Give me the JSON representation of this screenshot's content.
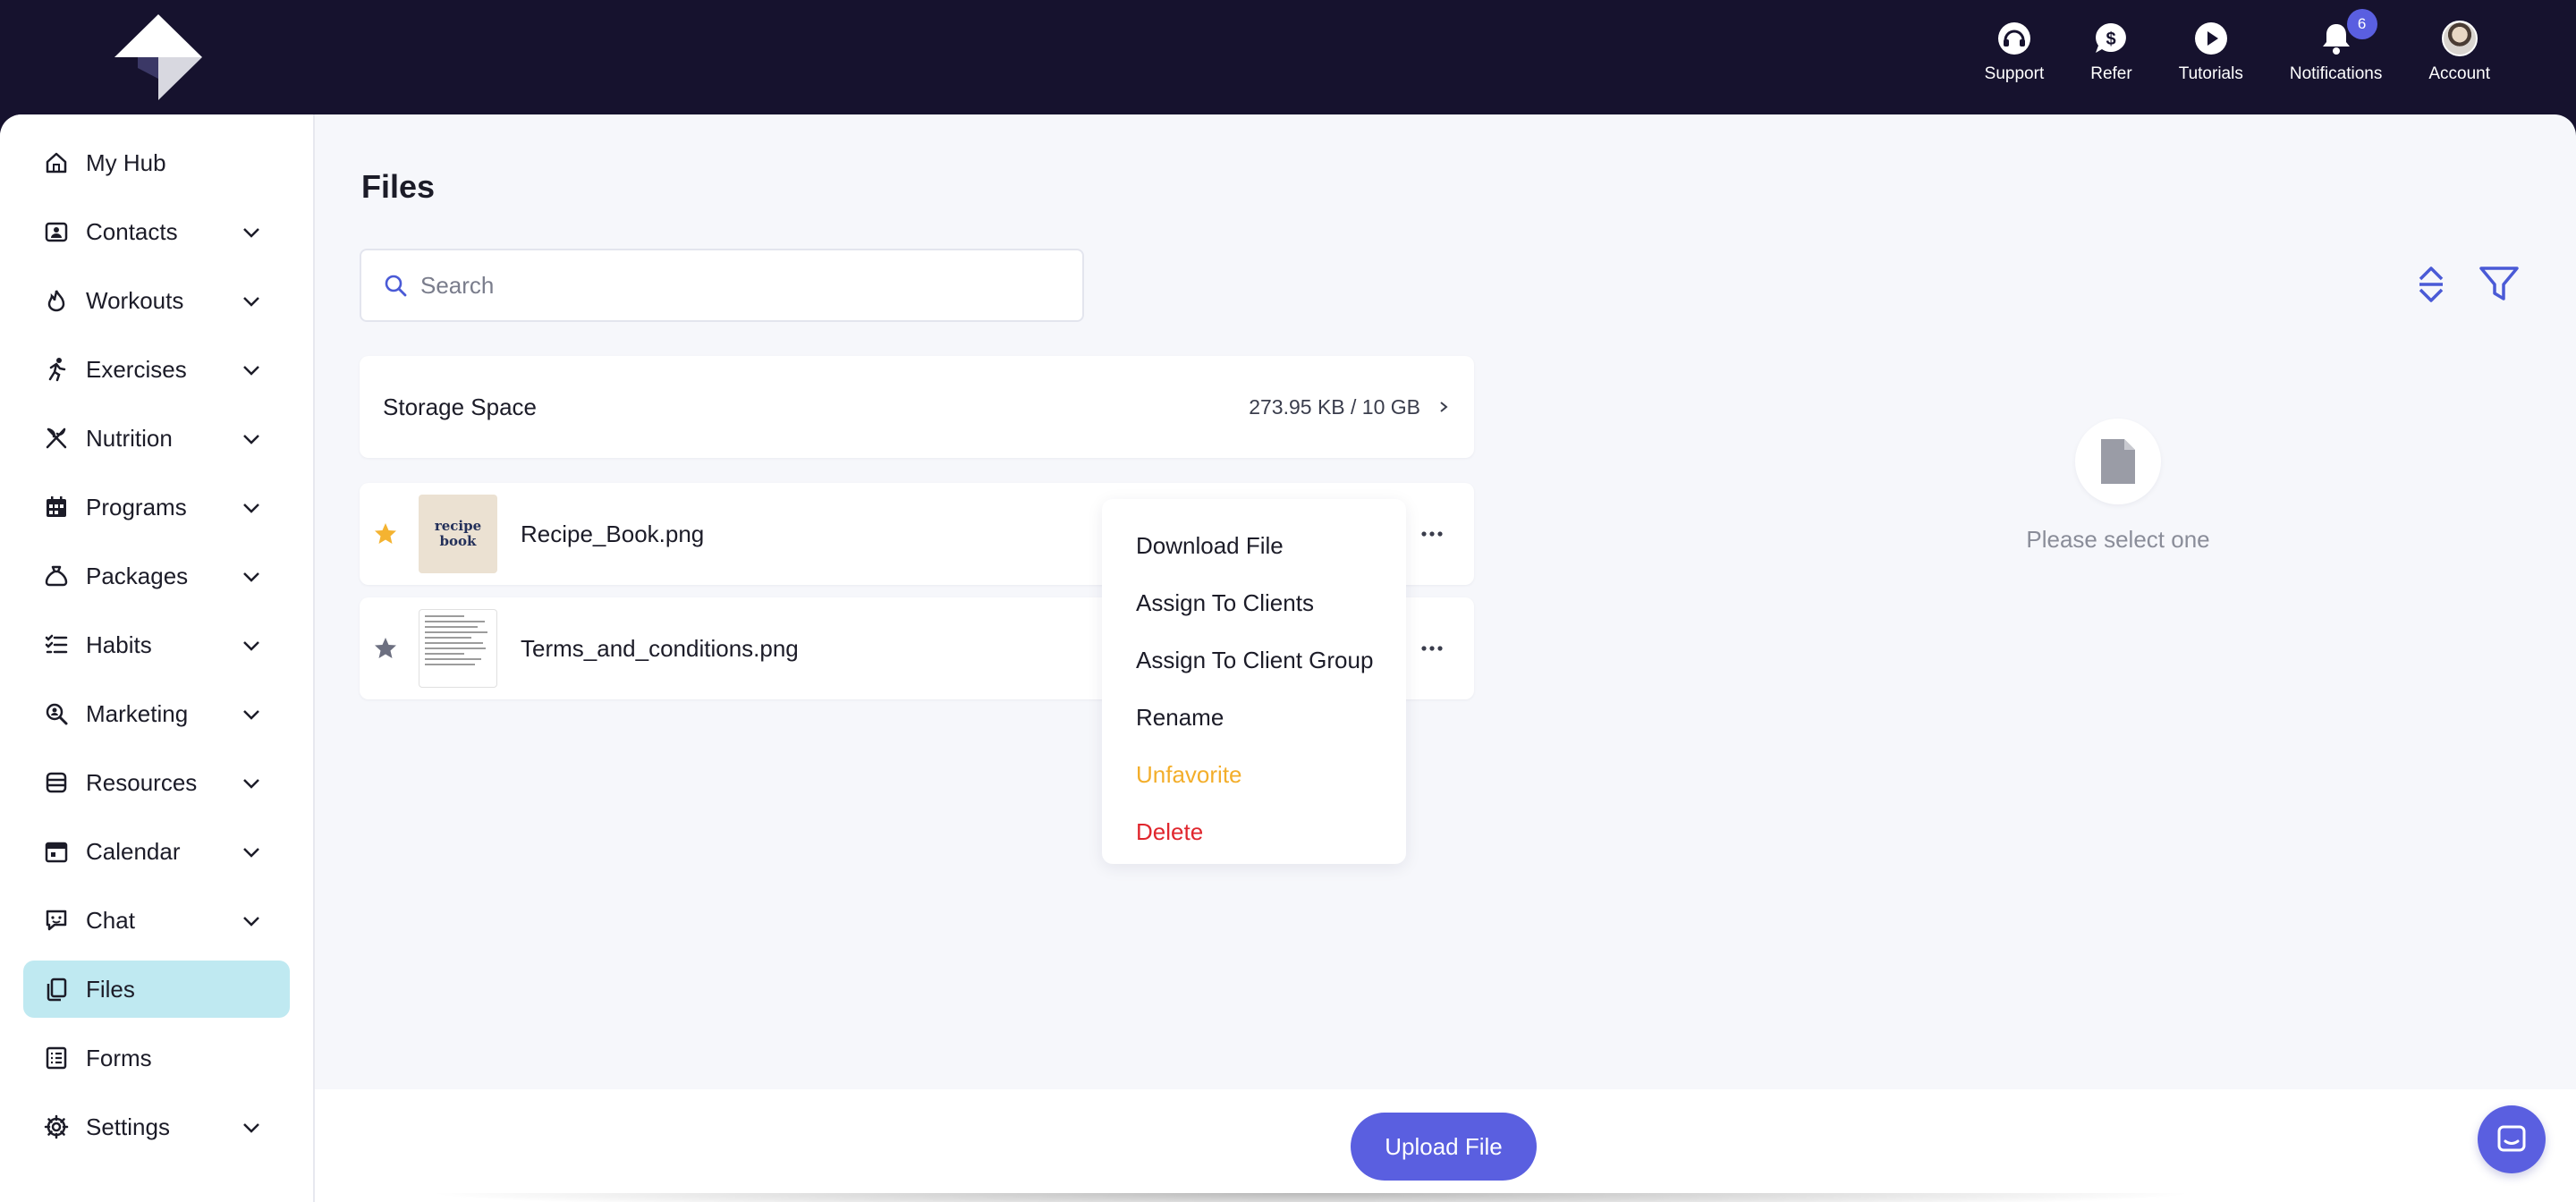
{
  "topbar": {
    "items": [
      {
        "label": "Support",
        "icon": "headset-icon"
      },
      {
        "label": "Refer",
        "icon": "dollar-chat-icon"
      },
      {
        "label": "Tutorials",
        "icon": "play-icon"
      },
      {
        "label": "Notifications",
        "icon": "bell-icon",
        "badge": "6"
      },
      {
        "label": "Account",
        "icon": "avatar"
      }
    ]
  },
  "sidebar": {
    "items": [
      {
        "label": "My Hub",
        "icon": "home-icon"
      },
      {
        "label": "Contacts",
        "icon": "contact-card-icon"
      },
      {
        "label": "Workouts",
        "icon": "flame-icon"
      },
      {
        "label": "Exercises",
        "icon": "running-icon"
      },
      {
        "label": "Nutrition",
        "icon": "utensils-icon"
      },
      {
        "label": "Programs",
        "icon": "calendar-grid-icon"
      },
      {
        "label": "Packages",
        "icon": "money-bag-icon"
      },
      {
        "label": "Habits",
        "icon": "checklist-icon"
      },
      {
        "label": "Marketing",
        "icon": "magnifier-icon"
      },
      {
        "label": "Resources",
        "icon": "database-icon"
      },
      {
        "label": "Calendar",
        "icon": "calendar-icon"
      },
      {
        "label": "Chat",
        "icon": "chat-icon"
      },
      {
        "label": "Files",
        "icon": "files-icon",
        "active": true
      },
      {
        "label": "Forms",
        "icon": "form-icon"
      },
      {
        "label": "Settings",
        "icon": "gear-icon"
      }
    ]
  },
  "main": {
    "title": "Files",
    "search_placeholder": "Search",
    "storage": {
      "label": "Storage Space",
      "value": "273.95 KB / 10 GB"
    },
    "files": [
      {
        "name": "Recipe_Book.png",
        "favorite": true,
        "thumb_text_1": "recipe",
        "thumb_text_2": "book"
      },
      {
        "name": "Terms_and_conditions.png",
        "favorite": false
      }
    ],
    "context_menu": {
      "items": [
        "Download File",
        "Assign To Clients",
        "Assign To Client Group",
        "Rename",
        "Unfavorite",
        "Delete"
      ]
    },
    "empty_state": {
      "text": "Please select one"
    }
  },
  "footer": {
    "upload_label": "Upload File"
  },
  "colors": {
    "topbar_bg": "#16122e",
    "accent": "#5a5fe0",
    "active_nav": "#bfe9f1",
    "favorite_star": "#f4b331",
    "unfavorite": "#f3ae2b",
    "delete": "#e0262d"
  }
}
